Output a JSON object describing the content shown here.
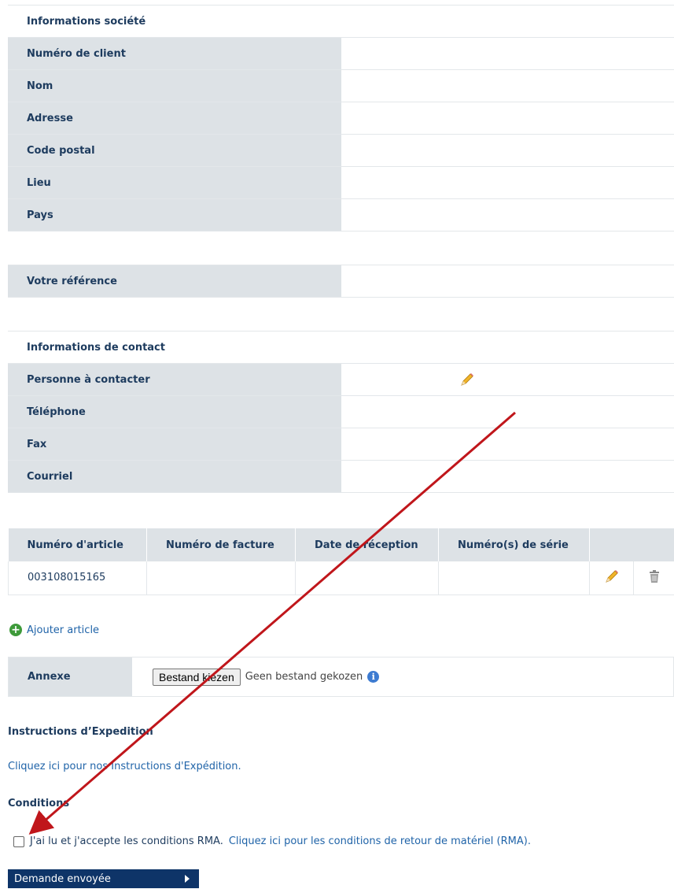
{
  "company": {
    "section_title": "Informations société",
    "fields": [
      {
        "label": "Numéro de client",
        "value": ""
      },
      {
        "label": "Nom",
        "value": ""
      },
      {
        "label": "Adresse",
        "value": ""
      },
      {
        "label": "Code postal",
        "value": ""
      },
      {
        "label": "Lieu",
        "value": ""
      },
      {
        "label": "Pays",
        "value": ""
      }
    ],
    "reference_label": "Votre référence"
  },
  "contact": {
    "section_title": "Informations de contact",
    "fields": [
      {
        "label": "Personne à contacter",
        "icon": "pencil-icon"
      },
      {
        "label": "Téléphone"
      },
      {
        "label": "Fax"
      },
      {
        "label": "Courriel"
      }
    ]
  },
  "articles": {
    "columns": [
      "Numéro d'article",
      "Numéro de facture",
      "Date de réception",
      "Numéro(s) de série"
    ],
    "rows": [
      {
        "article": "003108015165",
        "invoice": "",
        "date": "",
        "serial": ""
      }
    ],
    "add_label": "Ajouter article"
  },
  "annex": {
    "label": "Annexe",
    "file_button": "Bestand kiezen",
    "file_status": "Geen bestand gekozen",
    "info_icon": "info-icon"
  },
  "shipping": {
    "heading": "Instructions d’Expedition",
    "link": "Cliquez ici pour nos Instructions d'Expédition."
  },
  "conditions": {
    "heading": "Conditions",
    "accept_text": "J'ai lu et j'accepte les conditions RMA.",
    "link": "Cliquez ici pour les conditions de retour de matériel (RMA)."
  },
  "submit": {
    "label": "Demande envoyée",
    "icon": "play-icon"
  },
  "colors": {
    "label_bg": "#dde2e6",
    "text": "#1d3b5e",
    "link": "#1f63a8",
    "button": "#0e3468",
    "annotation_arrow": "#c0161b"
  }
}
